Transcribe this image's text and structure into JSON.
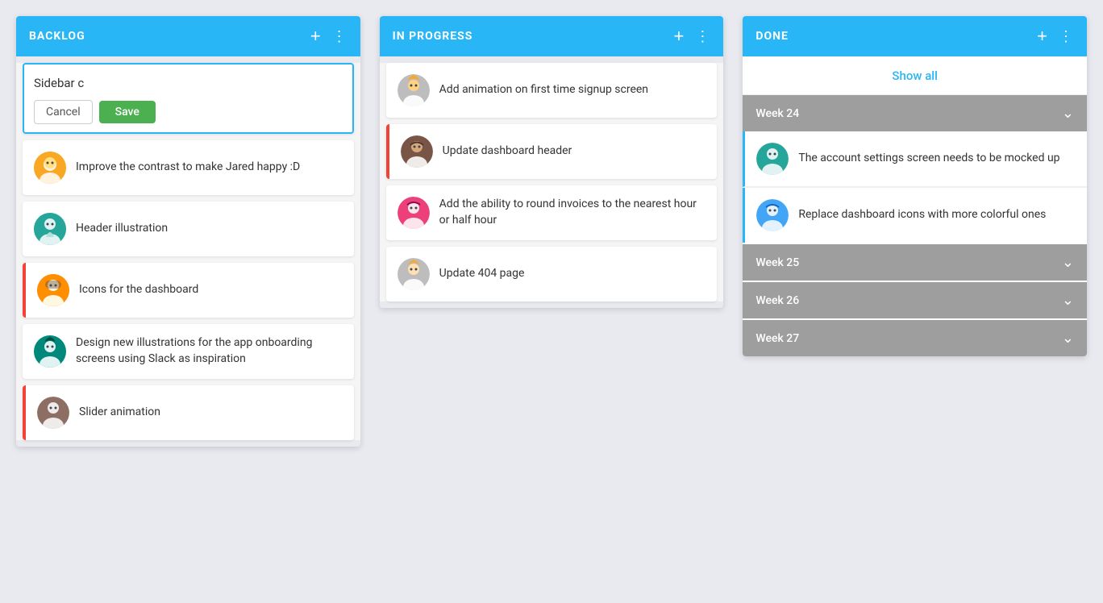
{
  "columns": {
    "backlog": {
      "title": "BACKLOG",
      "new_card": {
        "input_value": "Sidebar c",
        "cancel_label": "Cancel",
        "save_label": "Save"
      },
      "cards": [
        {
          "id": "bl1",
          "text": "Improve the contrast to make Jared happy :D",
          "accent": "none",
          "avatar_color": "yellow"
        },
        {
          "id": "bl2",
          "text": "Header illustration",
          "accent": "none",
          "avatar_color": "teal"
        },
        {
          "id": "bl3",
          "text": "Icons for the dashboard",
          "accent": "red",
          "avatar_color": "orange"
        },
        {
          "id": "bl4",
          "text": "Design new illustrations for the app onboarding screens using Slack as inspiration",
          "accent": "none",
          "avatar_color": "teal2"
        },
        {
          "id": "bl5",
          "text": "Slider animation",
          "accent": "red",
          "avatar_color": "brown"
        }
      ]
    },
    "in_progress": {
      "title": "IN PROGRESS",
      "cards": [
        {
          "id": "ip1",
          "text": "Add animation on first time signup screen",
          "accent": "none",
          "avatar_color": "blonde"
        },
        {
          "id": "ip2",
          "text": "Update dashboard header",
          "accent": "red",
          "avatar_color": "dark_woman"
        },
        {
          "id": "ip3",
          "text": "Add the ability to round invoices to the nearest hour or half hour",
          "accent": "none",
          "avatar_color": "redhead"
        },
        {
          "id": "ip4",
          "text": "Update 404 page",
          "accent": "none",
          "avatar_color": "blonde2"
        }
      ]
    },
    "done": {
      "title": "DONE",
      "show_all_label": "Show all",
      "weeks": [
        {
          "label": "Week 24",
          "cards": [
            {
              "id": "d1",
              "text": "The account settings screen needs to be mocked up",
              "avatar_color": "teal3"
            },
            {
              "id": "d2",
              "text": "Replace dashboard icons with more colorful ones",
              "avatar_color": "blue_woman"
            }
          ]
        },
        {
          "label": "Week 25",
          "cards": []
        },
        {
          "label": "Week 26",
          "cards": []
        },
        {
          "label": "Week 27",
          "cards": []
        }
      ]
    }
  }
}
